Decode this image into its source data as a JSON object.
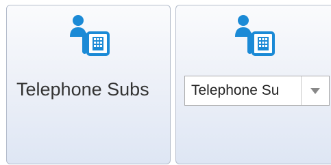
{
  "tiles": [
    {
      "icon": "telephone-subscriber-icon",
      "label": "Telephone Subs"
    },
    {
      "icon": "telephone-subscriber-icon",
      "dropdown": {
        "selected_value": "Telephone Su",
        "arrow_icon": "chevron-down-icon"
      }
    }
  ],
  "colors": {
    "icon_blue": "#1b8ad6",
    "tile_border": "#b4bccb",
    "tile_gradient_top": "#fafbfd",
    "tile_gradient_bottom": "#dee6f4",
    "arrow_gray": "#888888"
  }
}
